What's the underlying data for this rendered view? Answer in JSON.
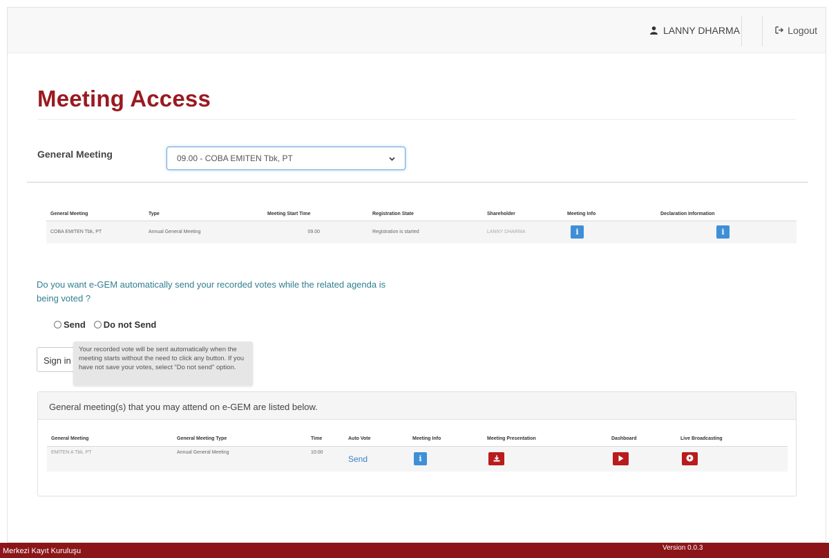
{
  "header": {
    "user_name": "LANNY DHARMA",
    "user_icon": "user-icon",
    "logout_label": "Logout",
    "logout_icon": "sign-out-icon"
  },
  "page": {
    "title": "Meeting Access"
  },
  "general_meeting": {
    "label": "General Meeting",
    "selected": "09.00 - COBA EMITEN Tbk, PT"
  },
  "registration_table": {
    "headers": [
      "General Meeting",
      "Type",
      "Meeting Start Time",
      "Registration State",
      "Shareholder",
      "Meeting Info",
      "Declaration Information"
    ],
    "rows": [
      {
        "general_meeting": "COBA EMITEN Tbk, PT",
        "type": "Annual General Meeting",
        "start_time": "09.00",
        "registration_state": "Registration is started",
        "shareholder": "LANNY DHARMA"
      }
    ]
  },
  "auto_vote": {
    "question": "Do you want e-GEM automatically send your recorded votes while the related agenda is being voted ?",
    "option_send": "Send",
    "option_do_not_send": "Do not Send",
    "tooltip": "Your recorded vote will be sent automatically when the meeting starts without the need to click any button. If you have not save your votes, select \"Do not send\" option."
  },
  "sign_in_label": "Sign in",
  "attend_panel": {
    "heading": "General meeting(s) that you may attend on e-GEM are listed below.",
    "headers": [
      "General Meeting",
      "General Meeting Type",
      "Time",
      "Auto Vote",
      "Meeting Info",
      "Meeting Presentation",
      "Dashboard",
      "Live Broadcasting"
    ],
    "rows": [
      {
        "general_meeting": "EMITEN A Tbk, PT",
        "type": "Annual General Meeting",
        "time": "10:00",
        "auto_vote": "Send"
      }
    ]
  },
  "footer": {
    "left": "Merkezi Kayıt Kuruluşu",
    "version": "Version 0.0.3"
  },
  "colors": {
    "brand_red": "#9a1a21",
    "footer_red": "#8b1519",
    "info_blue": "#3f8fd6",
    "action_red": "#b81c1c",
    "question_teal": "#317f8f"
  }
}
